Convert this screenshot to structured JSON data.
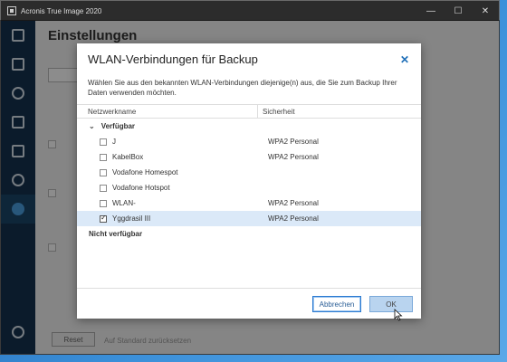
{
  "window": {
    "title": "Acronis True Image 2020",
    "minimize": "—",
    "maximize": "☐",
    "close": "✕"
  },
  "background_page": {
    "heading": "Einstellungen",
    "reset_button": "Reset",
    "restore_default": "Auf Standard zurücksetzen"
  },
  "dialog": {
    "title": "WLAN-Verbindungen für Backup",
    "close_icon": "✕",
    "description": "Wählen Sie aus den bekannten WLAN-Verbindungen diejenige(n) aus, die Sie zum Backup Ihrer Daten verwenden möchten.",
    "columns": {
      "name": "Netzwerkname",
      "security": "Sicherheit"
    },
    "groups": {
      "available": "Verfügbar",
      "unavailable": "Nicht verfügbar"
    },
    "networks": [
      {
        "name": "J",
        "security": "WPA2 Personal",
        "checked": false
      },
      {
        "name": "KabelBox",
        "security": "WPA2 Personal",
        "checked": false
      },
      {
        "name": "Vodafone Homespot",
        "security": "",
        "checked": false
      },
      {
        "name": "Vodafone Hotspot",
        "security": "",
        "checked": false
      },
      {
        "name": "WLAN-",
        "security": "WPA2 Personal",
        "checked": false
      },
      {
        "name": "Yggdrasil III",
        "security": "WPA2 Personal",
        "checked": true
      }
    ],
    "buttons": {
      "cancel": "Abbrechen",
      "ok": "OK"
    }
  },
  "colors": {
    "accent": "#2a7ad1",
    "sidebar": "#14324f",
    "selected_row": "#dbe9f8"
  }
}
